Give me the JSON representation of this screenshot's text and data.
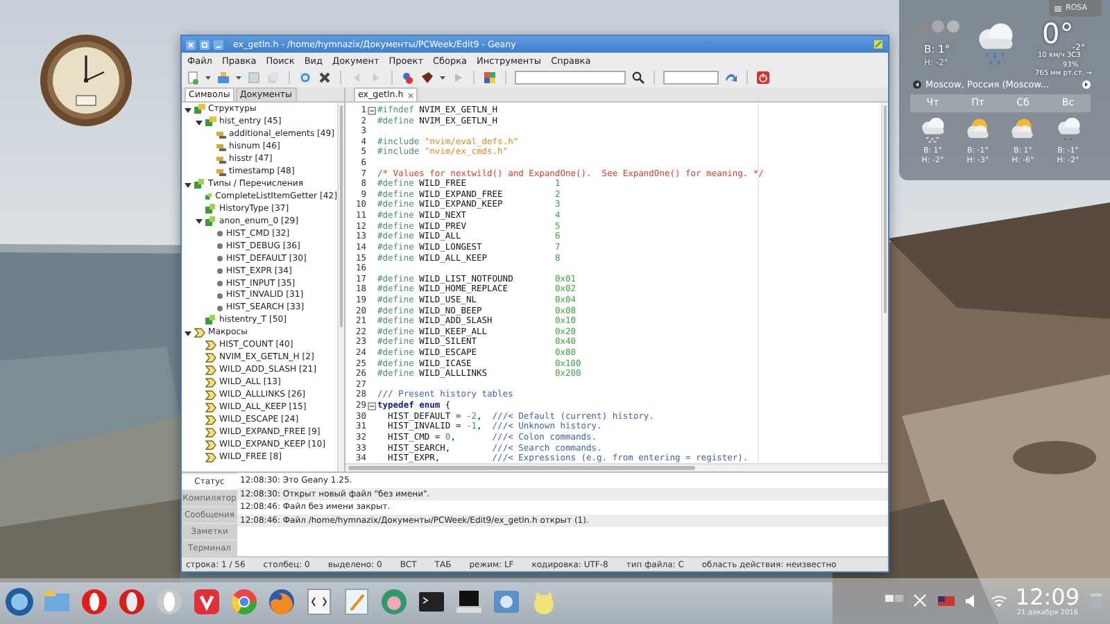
{
  "window": {
    "title": "ex_getln.h - /home/hymnazix/Документы/PCWeek/Edit9 - Geany"
  },
  "menu": [
    "Файл",
    "Правка",
    "Поиск",
    "Вид",
    "Документ",
    "Проект",
    "Сборка",
    "Инструменты",
    "Справка"
  ],
  "sidebar": {
    "tabs": [
      {
        "label": "Символы",
        "selected": true
      },
      {
        "label": "Документы",
        "selected": false
      }
    ],
    "tree": [
      {
        "label": "Структуры",
        "kind": "struct",
        "expanded": true,
        "children": [
          {
            "label": "hist_entry [45]",
            "kind": "struct",
            "expanded": true,
            "children": [
              {
                "label": "additional_elements [49]",
                "kind": "member"
              },
              {
                "label": "hisnum [46]",
                "kind": "member"
              },
              {
                "label": "hisstr [47]",
                "kind": "member"
              },
              {
                "label": "timestamp [48]",
                "kind": "member"
              }
            ]
          }
        ]
      },
      {
        "label": "Типы / Перечисления",
        "kind": "type",
        "expanded": true,
        "children": [
          {
            "label": "CompleteListItemGetter [42]",
            "kind": "type"
          },
          {
            "label": "HistoryType [37]",
            "kind": "type"
          },
          {
            "label": "anon_enum_0 [29]",
            "kind": "type",
            "expanded": true,
            "children": [
              {
                "label": "HIST_CMD [32]",
                "kind": "enumval"
              },
              {
                "label": "HIST_DEBUG [36]",
                "kind": "enumval"
              },
              {
                "label": "HIST_DEFAULT [30]",
                "kind": "enumval"
              },
              {
                "label": "HIST_EXPR [34]",
                "kind": "enumval"
              },
              {
                "label": "HIST_INPUT [35]",
                "kind": "enumval"
              },
              {
                "label": "HIST_INVALID [31]",
                "kind": "enumval"
              },
              {
                "label": "HIST_SEARCH [33]",
                "kind": "enumval"
              }
            ]
          },
          {
            "label": "histentry_T [50]",
            "kind": "type"
          }
        ]
      },
      {
        "label": "Макросы",
        "kind": "macro",
        "expanded": true,
        "children": [
          {
            "label": "HIST_COUNT [40]",
            "kind": "macro"
          },
          {
            "label": "NVIM_EX_GETLN_H [2]",
            "kind": "macro"
          },
          {
            "label": "WILD_ADD_SLASH [21]",
            "kind": "macro"
          },
          {
            "label": "WILD_ALL [13]",
            "kind": "macro"
          },
          {
            "label": "WILD_ALLLINKS [26]",
            "kind": "macro"
          },
          {
            "label": "WILD_ALL_KEEP [15]",
            "kind": "macro"
          },
          {
            "label": "WILD_ESCAPE [24]",
            "kind": "macro"
          },
          {
            "label": "WILD_EXPAND_FREE [9]",
            "kind": "macro"
          },
          {
            "label": "WILD_EXPAND_KEEP [10]",
            "kind": "macro"
          },
          {
            "label": "WILD_FREE [8]",
            "kind": "macro"
          }
        ]
      }
    ]
  },
  "editor": {
    "tabs": [
      {
        "label": "ex_getln.h",
        "selected": true
      }
    ],
    "lines": [
      {
        "n": "1",
        "fold": true,
        "parts": [
          {
            "kind": "d",
            "text": "#ifndef"
          },
          {
            "kind": "i",
            "text": " NVIM_EX_GETLN_H"
          }
        ]
      },
      {
        "n": "2",
        "parts": [
          {
            "kind": "d",
            "text": "#define"
          },
          {
            "kind": "i",
            "text": " NVIM_EX_GETLN_H"
          }
        ]
      },
      {
        "n": "3"
      },
      {
        "n": "4",
        "parts": [
          {
            "kind": "d",
            "text": "#include"
          },
          {
            "kind": "s",
            "text": " \"nvim/eval_defs.h\""
          }
        ]
      },
      {
        "n": "5",
        "parts": [
          {
            "kind": "d",
            "text": "#include"
          },
          {
            "kind": "s",
            "text": " \"nvim/ex_cmds.h\""
          }
        ]
      },
      {
        "n": "6"
      },
      {
        "n": "7",
        "parts": [
          {
            "kind": "c",
            "text": "/* Values for nextwild() and ExpandOne().  See ExpandOne() for meaning. */"
          }
        ]
      },
      {
        "n": "8",
        "parts": [
          {
            "kind": "d",
            "text": "#define"
          },
          {
            "kind": "i",
            "text": " WILD_FREE                 "
          },
          {
            "kind": "n",
            "text": "1"
          }
        ]
      },
      {
        "n": "9",
        "parts": [
          {
            "kind": "d",
            "text": "#define"
          },
          {
            "kind": "i",
            "text": " WILD_EXPAND_FREE          "
          },
          {
            "kind": "n",
            "text": "2"
          }
        ]
      },
      {
        "n": "10",
        "parts": [
          {
            "kind": "d",
            "text": "#define"
          },
          {
            "kind": "i",
            "text": " WILD_EXPAND_KEEP          "
          },
          {
            "kind": "n",
            "text": "3"
          }
        ]
      },
      {
        "n": "11",
        "parts": [
          {
            "kind": "d",
            "text": "#define"
          },
          {
            "kind": "i",
            "text": " WILD_NEXT                 "
          },
          {
            "kind": "n",
            "text": "4"
          }
        ]
      },
      {
        "n": "12",
        "parts": [
          {
            "kind": "d",
            "text": "#define"
          },
          {
            "kind": "i",
            "text": " WILD_PREV                 "
          },
          {
            "kind": "n",
            "text": "5"
          }
        ]
      },
      {
        "n": "13",
        "parts": [
          {
            "kind": "d",
            "text": "#define"
          },
          {
            "kind": "i",
            "text": " WILD_ALL                  "
          },
          {
            "kind": "n",
            "text": "6"
          }
        ]
      },
      {
        "n": "14",
        "parts": [
          {
            "kind": "d",
            "text": "#define"
          },
          {
            "kind": "i",
            "text": " WILD_LONGEST              "
          },
          {
            "kind": "n",
            "text": "7"
          }
        ]
      },
      {
        "n": "15",
        "parts": [
          {
            "kind": "d",
            "text": "#define"
          },
          {
            "kind": "i",
            "text": " WILD_ALL_KEEP             "
          },
          {
            "kind": "n",
            "text": "8"
          }
        ]
      },
      {
        "n": "16"
      },
      {
        "n": "17",
        "parts": [
          {
            "kind": "d",
            "text": "#define"
          },
          {
            "kind": "i",
            "text": " WILD_LIST_NOTFOUND        "
          },
          {
            "kind": "n",
            "text": "0x01"
          }
        ]
      },
      {
        "n": "18",
        "parts": [
          {
            "kind": "d",
            "text": "#define"
          },
          {
            "kind": "i",
            "text": " WILD_HOME_REPLACE         "
          },
          {
            "kind": "n",
            "text": "0x02"
          }
        ]
      },
      {
        "n": "19",
        "parts": [
          {
            "kind": "d",
            "text": "#define"
          },
          {
            "kind": "i",
            "text": " WILD_USE_NL               "
          },
          {
            "kind": "n",
            "text": "0x04"
          }
        ]
      },
      {
        "n": "20",
        "parts": [
          {
            "kind": "d",
            "text": "#define"
          },
          {
            "kind": "i",
            "text": " WILD_NO_BEEP              "
          },
          {
            "kind": "n",
            "text": "0x08"
          }
        ]
      },
      {
        "n": "21",
        "parts": [
          {
            "kind": "d",
            "text": "#define"
          },
          {
            "kind": "i",
            "text": " WILD_ADD_SLASH            "
          },
          {
            "kind": "n",
            "text": "0x10"
          }
        ]
      },
      {
        "n": "22",
        "parts": [
          {
            "kind": "d",
            "text": "#define"
          },
          {
            "kind": "i",
            "text": " WILD_KEEP_ALL             "
          },
          {
            "kind": "n",
            "text": "0x20"
          }
        ]
      },
      {
        "n": "23",
        "parts": [
          {
            "kind": "d",
            "text": "#define"
          },
          {
            "kind": "i",
            "text": " WILD_SILENT               "
          },
          {
            "kind": "n",
            "text": "0x40"
          }
        ]
      },
      {
        "n": "24",
        "parts": [
          {
            "kind": "d",
            "text": "#define"
          },
          {
            "kind": "i",
            "text": " WILD_ESCAPE               "
          },
          {
            "kind": "n",
            "text": "0x80"
          }
        ]
      },
      {
        "n": "25",
        "parts": [
          {
            "kind": "d",
            "text": "#define"
          },
          {
            "kind": "i",
            "text": " WILD_ICASE                "
          },
          {
            "kind": "n",
            "text": "0x100"
          }
        ]
      },
      {
        "n": "26",
        "parts": [
          {
            "kind": "d",
            "text": "#define"
          },
          {
            "kind": "i",
            "text": " WILD_ALLLINKS             "
          },
          {
            "kind": "n",
            "text": "0x200"
          }
        ]
      },
      {
        "n": "27"
      },
      {
        "n": "28",
        "parts": [
          {
            "kind": "dc",
            "text": "/// Present history tables"
          }
        ]
      },
      {
        "n": "29",
        "fold": true,
        "parts": [
          {
            "kind": "k",
            "text": "typedef enum"
          },
          {
            "kind": "p",
            "text": " {"
          }
        ]
      },
      {
        "n": "30",
        "parts": [
          {
            "kind": "p",
            "text": "  HIST_DEFAULT = "
          },
          {
            "kind": "n",
            "text": "-2"
          },
          {
            "kind": "p",
            "text": ",  "
          },
          {
            "kind": "dc",
            "text": "///< Default (current) history."
          }
        ]
      },
      {
        "n": "31",
        "parts": [
          {
            "kind": "p",
            "text": "  HIST_INVALID = "
          },
          {
            "kind": "n",
            "text": "-1"
          },
          {
            "kind": "p",
            "text": ",  "
          },
          {
            "kind": "dc",
            "text": "///< Unknown history."
          }
        ]
      },
      {
        "n": "32",
        "parts": [
          {
            "kind": "p",
            "text": "  HIST_CMD = "
          },
          {
            "kind": "n",
            "text": "0"
          },
          {
            "kind": "p",
            "text": ",       "
          },
          {
            "kind": "dc",
            "text": "///< Colon commands."
          }
        ]
      },
      {
        "n": "33",
        "parts": [
          {
            "kind": "p",
            "text": "  HIST_SEARCH,        "
          },
          {
            "kind": "dc",
            "text": "///< Search commands."
          }
        ]
      },
      {
        "n": "34",
        "parts": [
          {
            "kind": "p",
            "text": "  HIST_EXPR,          "
          },
          {
            "kind": "dc",
            "text": "///< Expressions (e.g. from entering = register)."
          }
        ]
      }
    ]
  },
  "messages": {
    "tabs": [
      {
        "label": "Статус",
        "selected": true
      },
      {
        "label": "Компилятор",
        "selected": false
      },
      {
        "label": "Сообщения",
        "selected": false
      },
      {
        "label": "Заметки",
        "selected": false
      },
      {
        "label": "Терминал",
        "selected": false
      }
    ],
    "log": [
      "12:08:30: Это Geany 1.25.",
      "12:08:30: Открыт новый файл \"без имени\".",
      "12:08:46: Файл без имени закрыт.",
      "12:08:46: Файл /home/hymnazix/Документы/PCWeek/Edit9/ex_getln.h открыт (1)."
    ]
  },
  "status_bar": [
    "строка: 1 / 56",
    "столбец: 0",
    "выделено: 0",
    "ВСТ",
    "ТАБ",
    "режим: LF",
    "кодировка: UTF-8",
    "тип файла: C",
    "область действия: неизвестно"
  ],
  "weather": {
    "panel_button": "ROSA",
    "current": {
      "kind": "rain",
      "high": "В: 1°",
      "low": "Н: -2°",
      "temp": "0°",
      "feels": "-2°",
      "wind": "10 км/ч ЗСЗ",
      "humidity": "93%",
      "pressure": "765 мм рт.ст. →"
    },
    "location": "Moscow, Россия (Moscow...",
    "days": [
      {
        "name": "Чт",
        "kind": "snow",
        "high": "В: 1°",
        "low": "Н: -2°"
      },
      {
        "name": "Пт",
        "kind": "sun-cloud",
        "high": "В: -1°",
        "low": "Н: -3°"
      },
      {
        "name": "Сб",
        "kind": "sun-cloud",
        "high": "В: 1°",
        "low": "Н: -6°"
      },
      {
        "name": "Вс",
        "kind": "light-snow",
        "high": "В: -1°",
        "low": "Н: -2°"
      }
    ]
  },
  "taskbar": {
    "time": "12:09",
    "date": "21 декабря 2016"
  }
}
